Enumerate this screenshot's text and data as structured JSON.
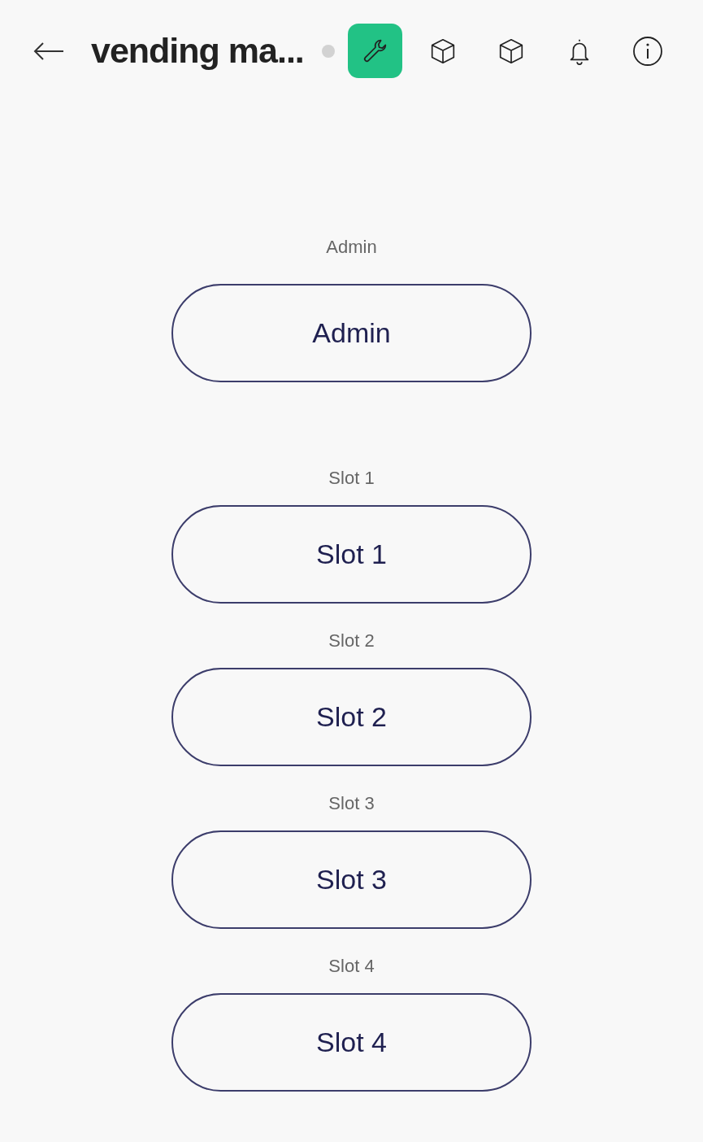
{
  "header": {
    "title": "vending ma..."
  },
  "toolbar": [
    {
      "kind": "wrench",
      "selected": true
    },
    {
      "kind": "box",
      "selected": false
    },
    {
      "kind": "box",
      "selected": false
    },
    {
      "kind": "bell",
      "selected": false
    },
    {
      "kind": "info",
      "selected": false
    }
  ],
  "admin": {
    "label": "Admin",
    "button": "Admin"
  },
  "slots": [
    {
      "label": "Slot 1",
      "button": "Slot 1"
    },
    {
      "label": "Slot 2",
      "button": "Slot 2"
    },
    {
      "label": "Slot 3",
      "button": "Slot 3"
    },
    {
      "label": "Slot 4",
      "button": "Slot 4"
    }
  ]
}
